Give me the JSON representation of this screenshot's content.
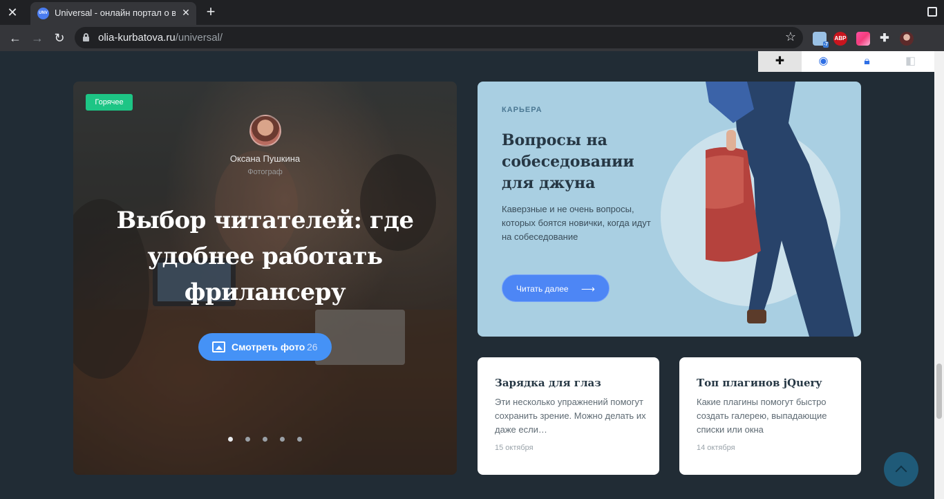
{
  "browser": {
    "tab_title": "Universal - онлайн портал о в…",
    "tab_favicon_text": "UNV",
    "url_host": "olia-kurbatova.ru",
    "url_path": "/universal/",
    "extensions": [
      "weather-icon",
      "adblock-icon",
      "color-picker-icon",
      "puzzle-icon",
      "profile-avatar"
    ],
    "adblock_label": "ABP",
    "weather_badge": "-7"
  },
  "hero": {
    "badge": "Горячее",
    "author_name": "Оксана Пушкина",
    "author_role": "Фотограф",
    "title": "Выбор читателей: где удобнее работать фрилансеру",
    "photo_button_label": "Смотреть фото",
    "photo_count": "26",
    "slides_total": 5,
    "active_slide": 1
  },
  "career": {
    "kicker": "КАРЬЕРА",
    "title": "Вопросы на собеседовании для джуна",
    "text": "Каверзные и не очень вопросы, которых боятся новички, когда идут на собеседование",
    "button_label": "Читать далее",
    "button_arrow": "⟶"
  },
  "cards": [
    {
      "title": "Зарядка для глаз",
      "text": "Эти несколько упражнений помогут сохранить зрение. Можно делать их даже если…",
      "date": "15 октября"
    },
    {
      "title": "Топ плагинов jQuery",
      "text": "Какие плагины помогут быстро создать галерею, выпадающие списки или окна",
      "date": "14 октября"
    }
  ],
  "colors": {
    "page_bg": "#212c35",
    "hot_badge": "#1dc585",
    "accent_blue": "#4592f6",
    "career_bg": "#a9cfe2"
  }
}
